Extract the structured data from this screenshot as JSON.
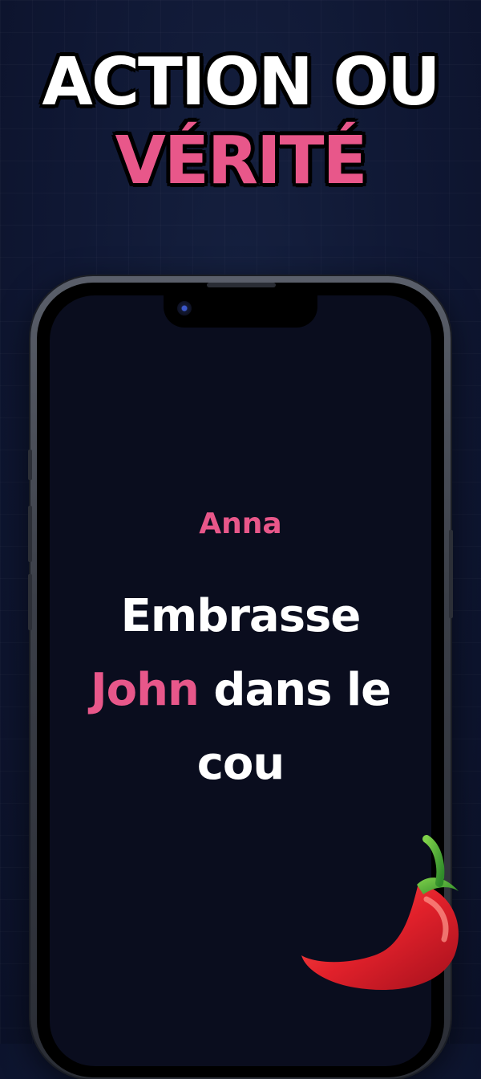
{
  "headline": {
    "line1": "ACTION OU",
    "line2": "VÉRITÉ"
  },
  "card": {
    "player_name": "Anna",
    "challenge_part1": "Embrasse",
    "challenge_highlight": "John",
    "challenge_part2": "dans le",
    "challenge_part3": "cou"
  },
  "colors": {
    "accent_pink": "#e8578a",
    "background": "#0f1733",
    "screen": "#0a0d1e"
  },
  "icons": {
    "decoration": "hot-pepper-icon"
  }
}
